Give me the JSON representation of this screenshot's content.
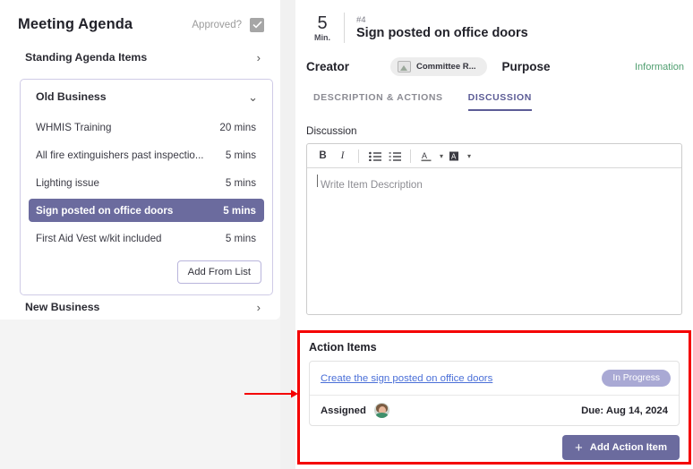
{
  "agenda": {
    "title": "Meeting Agenda",
    "approved_label": "Approved?",
    "approved_checked": true,
    "standing_section": "Standing Agenda Items",
    "old_business": {
      "label": "Old Business",
      "items": [
        {
          "name": "WHMIS Training",
          "mins": "20 mins",
          "selected": false
        },
        {
          "name": "All fire extinguishers past inspectio...",
          "mins": "5 mins",
          "selected": false
        },
        {
          "name": "Lighting issue",
          "mins": "5 mins",
          "selected": false
        },
        {
          "name": "Sign posted on office doors",
          "mins": "5 mins",
          "selected": true
        },
        {
          "name": "First Aid Vest w/kit included",
          "mins": "5 mins",
          "selected": false
        }
      ],
      "add_from_list_label": "Add From List"
    },
    "new_business": "New Business"
  },
  "detail": {
    "minutes": "5",
    "minutes_unit": "Min.",
    "item_number": "#4",
    "title": "Sign posted on office doors",
    "creator_label": "Creator",
    "creator_name": "Committee R...",
    "purpose_label": "Purpose",
    "purpose_value": "Information",
    "tabs": [
      {
        "label": "DESCRIPTION & ACTIONS",
        "active": false
      },
      {
        "label": "DISCUSSION",
        "active": true
      }
    ],
    "discussion_label": "Discussion",
    "editor": {
      "placeholder": "Write Item Description",
      "value": "",
      "toolbar": [
        {
          "name": "bold",
          "glyph": "B"
        },
        {
          "name": "italic",
          "glyph": "I"
        },
        {
          "name": "bulleted-list",
          "glyph": "☰"
        },
        {
          "name": "numbered-list",
          "glyph": "☰"
        },
        {
          "name": "text-color",
          "glyph": "A"
        },
        {
          "name": "highlight-color",
          "glyph": "A"
        }
      ]
    }
  },
  "action_items": {
    "title": "Action Items",
    "items": [
      {
        "link": "Create the sign posted on office doors",
        "status": "In Progress",
        "assigned_label": "Assigned",
        "due": "Due: Aug 14, 2024"
      }
    ],
    "add_button": "+ Add Action Item",
    "add_button_text": "Add Action Item"
  },
  "colors": {
    "accent_purple": "#6b6b9e",
    "status_pill": "#a9a9d4",
    "link_blue": "#4a6fd8",
    "purpose_green": "#4f9e6f",
    "annotation_red": "#f40000"
  }
}
